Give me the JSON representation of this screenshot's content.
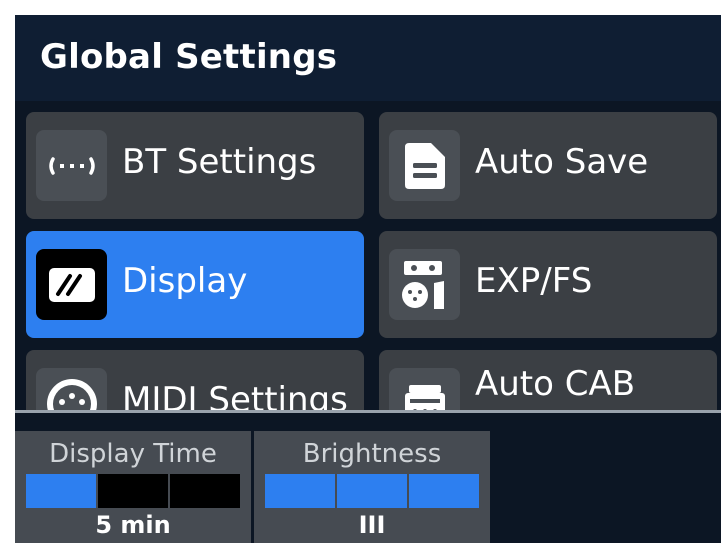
{
  "header": {
    "title": "Global Settings"
  },
  "tiles": [
    {
      "label": "BT Settings",
      "icon": "bluetooth-icon",
      "active": false
    },
    {
      "label": "Auto Save",
      "icon": "save-document-icon",
      "active": false
    },
    {
      "label": "Display",
      "icon": "display-icon",
      "active": true
    },
    {
      "label": "EXP/FS",
      "icon": "expression-footswitch-icon",
      "active": false
    },
    {
      "label": "MIDI Settings",
      "icon": "midi-icon",
      "active": false
    },
    {
      "label": "Auto CAB",
      "icon": "cabinet-icon",
      "active": false
    }
  ],
  "params": [
    {
      "label": "Display Time",
      "value": "5 min",
      "level_segments_on": 1,
      "segments_total": 3
    },
    {
      "label": "Brightness",
      "value": "III",
      "level_segments_on": 3,
      "segments_total": 3
    }
  ],
  "colors": {
    "accent": "#2d7ff0",
    "tile": "#3b3f44",
    "background": "#0c1624",
    "header": "#0f1e33"
  }
}
